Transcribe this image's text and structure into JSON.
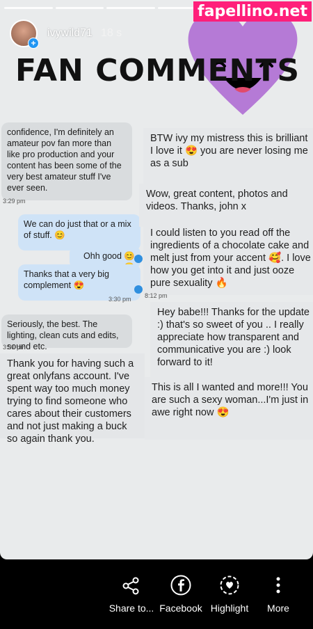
{
  "watermark": "fapellino.net",
  "header": {
    "username": "ivywild71",
    "time": "18 s"
  },
  "title": "FAN COMMENTS",
  "left_messages": [
    {
      "text": "confidence, I'm definitely an amateur pov fan more than like pro production and your content has been some of the very best amateur stuff I've ever seen."
    },
    {
      "text": "Seriously, the best. The lighting, clean cuts and edits, sound etc."
    }
  ],
  "right_messages": [
    {
      "text": "We can do just that or a mix of stuff. 😊"
    },
    {
      "text": "Ohh good 😊😊"
    },
    {
      "text": "Thanks that a very big complement 😍"
    }
  ],
  "timestamps": {
    "t1": "3:29 pm",
    "t2": "3:30 pm",
    "t3": "3:31 pm",
    "t4": "8:12 pm"
  },
  "long_left": "Thank you for having such a great onlyfans account. I've spent way too much money trying to find someone who cares about their customers and not just making a buck so again thank you.",
  "comments_right": [
    {
      "text": "BTW ivy my mistress this is brilliant I love it 😍 you are never losing me as a sub"
    },
    {
      "text": "Wow, great content, photos and videos. Thanks, john x"
    },
    {
      "text": "I could listen to you read off the ingredients of a chocolate cake and melt just from your accent 🥰. I love how you get into it and just ooze pure sexuality 🔥"
    },
    {
      "text": "Hey babe!!! Thanks for the update :) that's so sweet of you .. I really appreciate how transparent and communicative you are :) look forward to it!"
    },
    {
      "text": "This is all I wanted and more!!! You are such a sexy woman...I'm just in awe right now 😍"
    }
  ],
  "actions": [
    {
      "label": "Share to...",
      "icon": "share-icon"
    },
    {
      "label": "Facebook",
      "icon": "facebook-icon"
    },
    {
      "label": "Highlight",
      "icon": "highlight-icon"
    },
    {
      "label": "More",
      "icon": "more-icon"
    }
  ],
  "colors": {
    "accent": "#ff1f7a",
    "heart": "#b57ad6"
  }
}
